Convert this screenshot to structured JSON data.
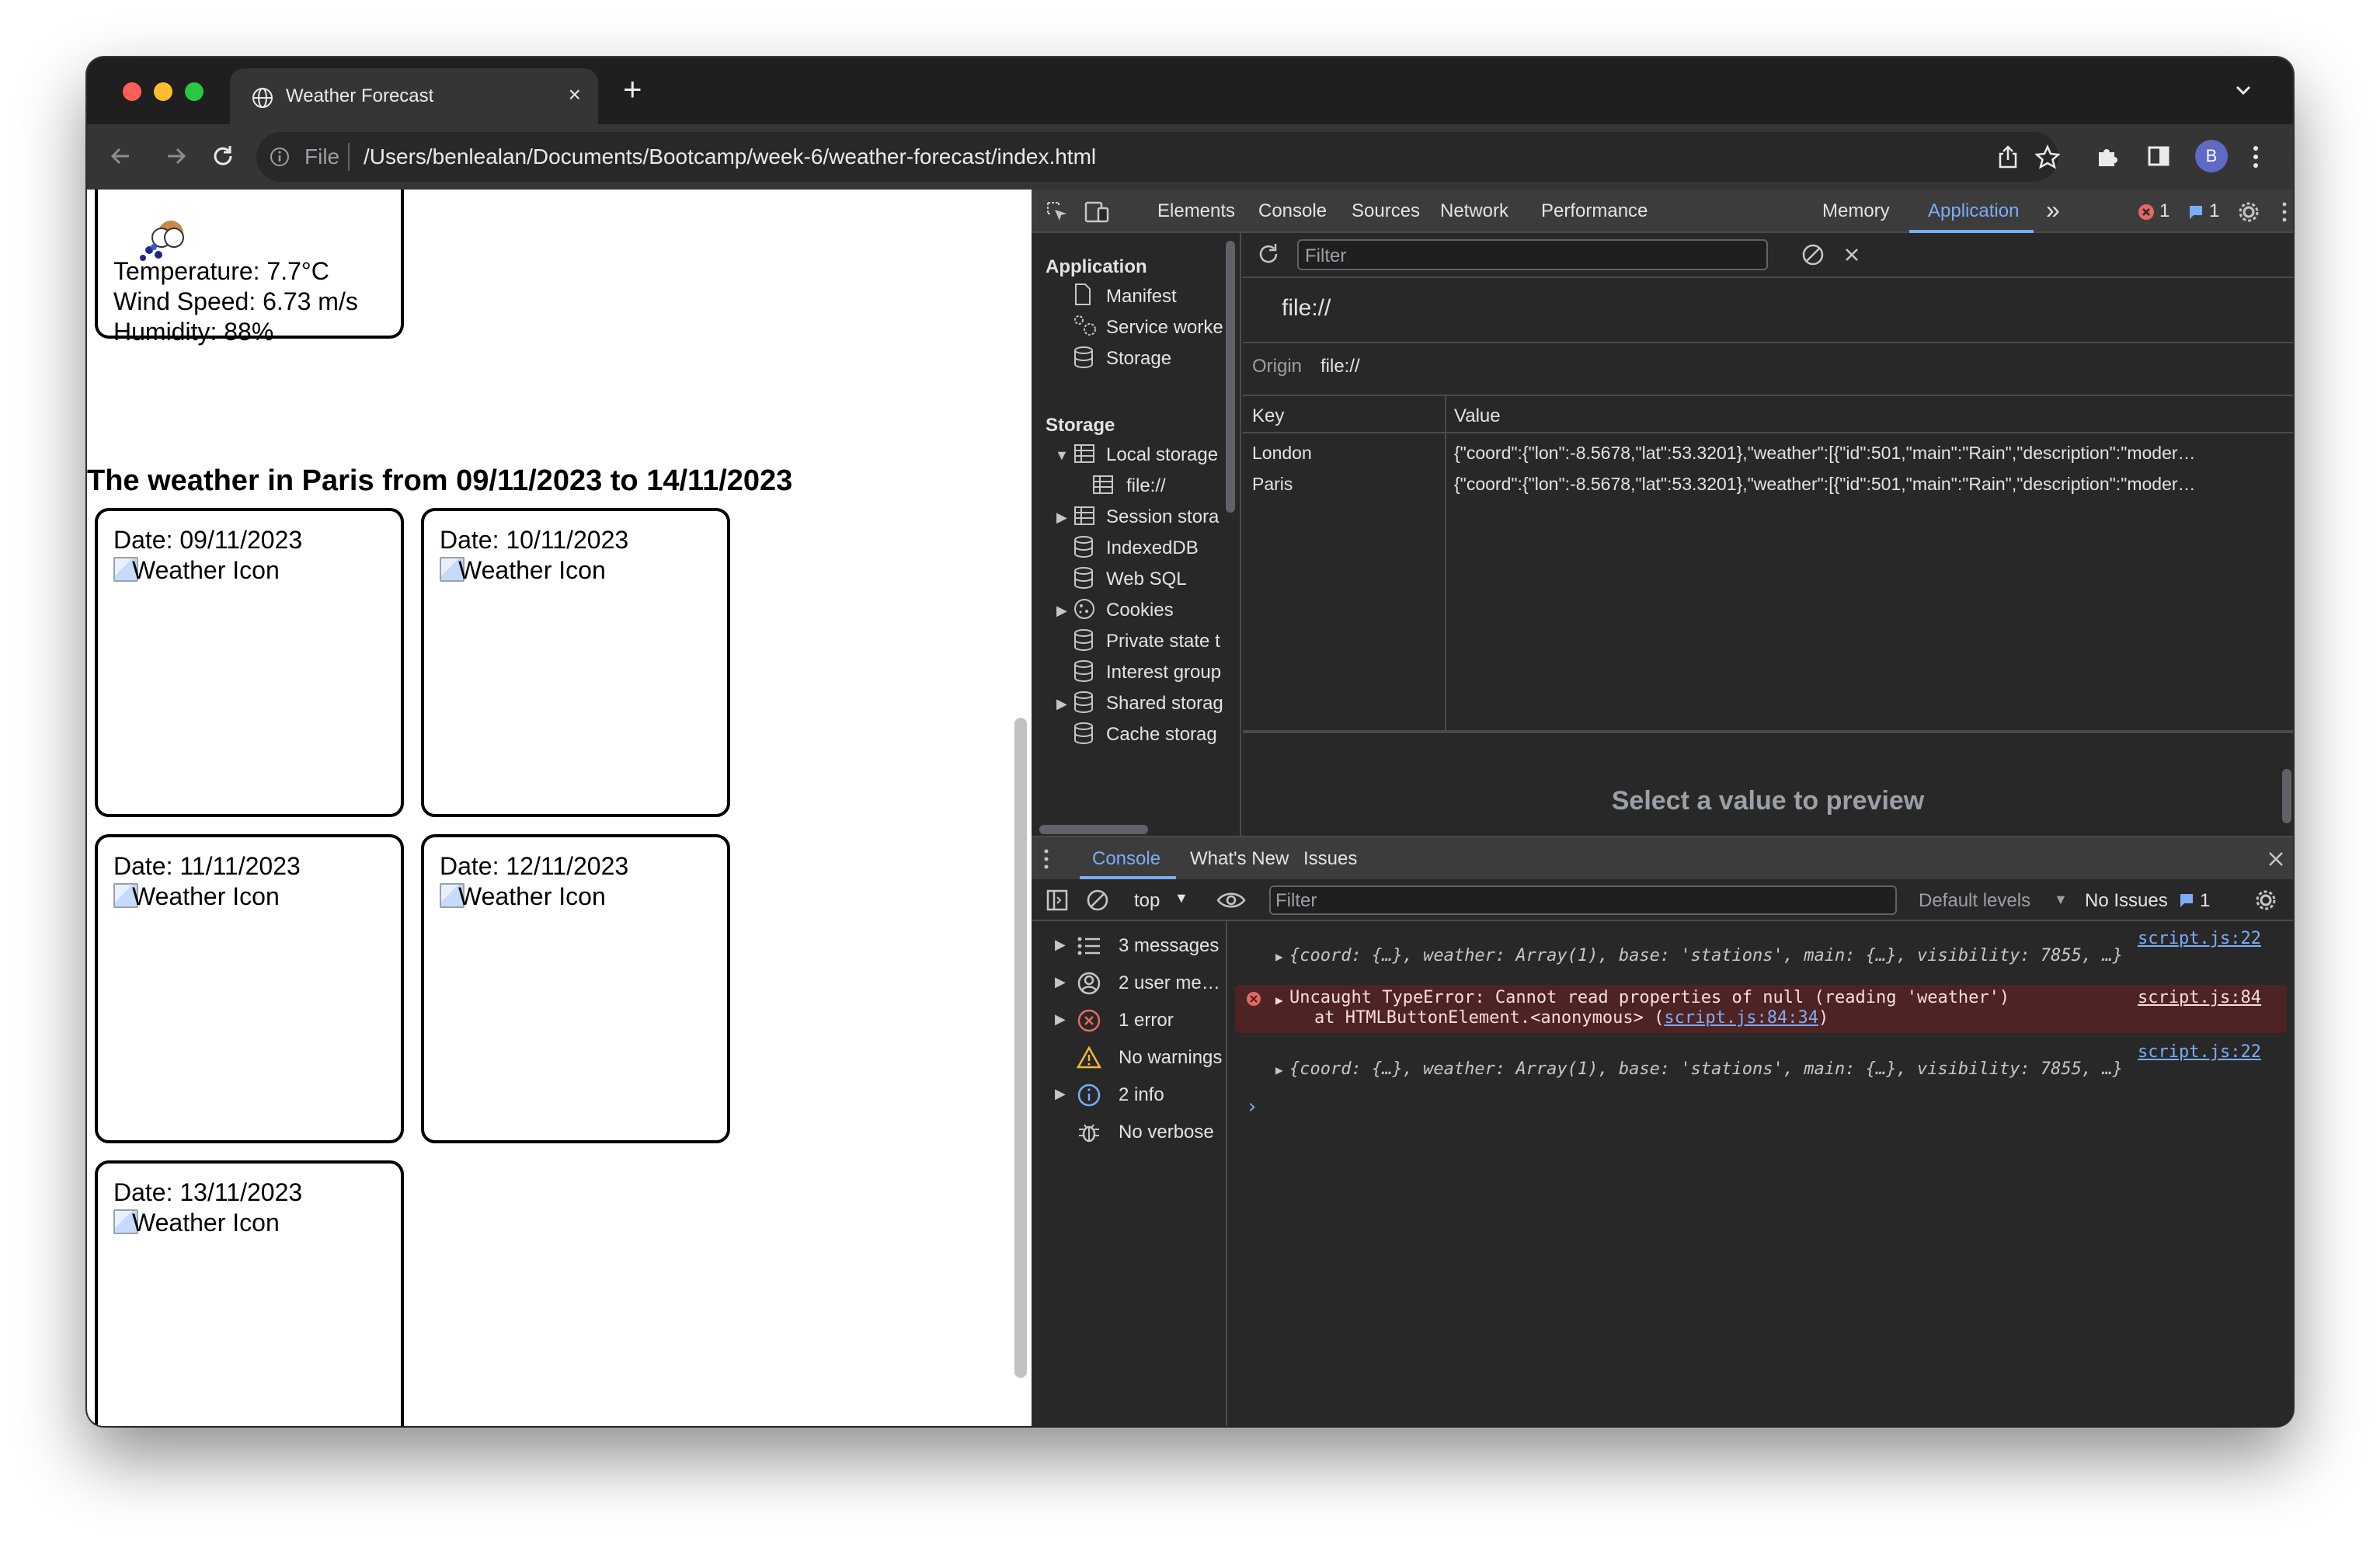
{
  "browser": {
    "tab_title": "Weather Forecast",
    "new_tab_symbol": "+",
    "close_symbol": "×",
    "address_scheme": "File",
    "address_url": "/Users/benlealan/Documents/Bootcamp/week-6/weather-forecast/index.html",
    "profile_initial": "B",
    "traffic_colors": [
      "#ff5f57",
      "#febc2e",
      "#28c840"
    ]
  },
  "page": {
    "top_card": {
      "temperature": "Temperature: 7.7°C",
      "wind": "Wind Speed: 6.73 m/s",
      "humidity": "Humidity: 88%"
    },
    "heading": "The weather in Paris from 09/11/2023 to 14/11/2023",
    "cards": [
      {
        "date": "Date: 09/11/2023",
        "icon_alt": "Weather Icon"
      },
      {
        "date": "Date: 10/11/2023",
        "icon_alt": "Weather Icon"
      },
      {
        "date": "Date: 11/11/2023",
        "icon_alt": "Weather Icon"
      },
      {
        "date": "Date: 12/11/2023",
        "icon_alt": "Weather Icon"
      },
      {
        "date": "Date: 13/11/2023",
        "icon_alt": "Weather Icon"
      }
    ]
  },
  "devtools": {
    "tabs": [
      "Elements",
      "Console",
      "Sources",
      "Network",
      "Performance",
      "Memory",
      "Application"
    ],
    "active_tab": "Application",
    "more_tabs": "»",
    "error_count": "1",
    "issue_count": "1",
    "sidebar": {
      "application_header": "Application",
      "application_items": [
        "Manifest",
        "Service worke",
        "Storage"
      ],
      "storage_header": "Storage",
      "storage_items": [
        "Local storage",
        "file://",
        "Session stora",
        "IndexedDB",
        "Web SQL",
        "Cookies",
        "Private state t",
        "Interest group",
        "Shared storag",
        "Cache storag"
      ]
    },
    "filter_placeholder": "Filter",
    "origin_heading": "file://",
    "origin_label": "Origin",
    "origin_value": "file://",
    "table_headers": [
      "Key",
      "Value"
    ],
    "rows": [
      {
        "key": "London",
        "value": "{\"coord\":{\"lon\":-8.5678,\"lat\":53.3201},\"weather\":[{\"id\":501,\"main\":\"Rain\",\"description\":\"moder…"
      },
      {
        "key": "Paris",
        "value": "{\"coord\":{\"lon\":-8.5678,\"lat\":53.3201},\"weather\":[{\"id\":501,\"main\":\"Rain\",\"description\":\"moder…"
      }
    ],
    "preview_text": "Select a value to preview"
  },
  "console": {
    "drawer_tabs": [
      "Console",
      "What's New",
      "Issues"
    ],
    "context": "top",
    "filter_placeholder": "Filter",
    "levels": "Default levels",
    "no_issues": "No Issues",
    "issues_count": "1",
    "side_items": [
      "3 messages",
      "2 user me…",
      "1 error",
      "No warnings",
      "2 info",
      "No verbose"
    ],
    "messages": [
      {
        "src": "script.js:22",
        "text": "{coord: {…}, weather: Array(1), base: 'stations', main: {…}, visibility: 7855, …}"
      },
      {
        "src": "script.js:84",
        "text": "Uncaught TypeError: Cannot read properties of null (reading 'weather')",
        "text2": "at HTMLButtonElement.<anonymous> (",
        "link2": "script.js:84:34",
        "close2": ")"
      },
      {
        "src": "script.js:22",
        "text": "{coord: {…}, weather: Array(1), base: 'stations', main: {…}, visibility: 7855, …}"
      }
    ],
    "prompt": "›"
  }
}
